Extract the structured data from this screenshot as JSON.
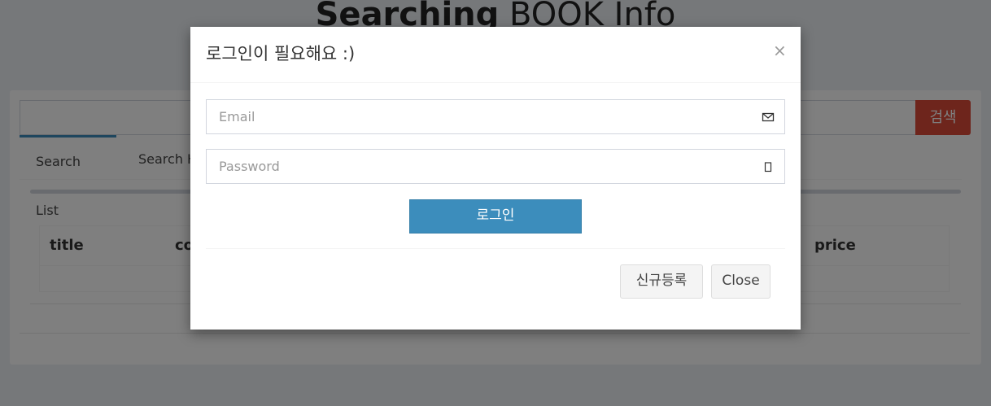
{
  "page": {
    "title_bold": "Searching",
    "title_light": " BOOK Info"
  },
  "search": {
    "button_label": "검색",
    "input_value": ""
  },
  "tabs": [
    {
      "label": "Search List",
      "active": true
    },
    {
      "label": "Search H"
    }
  ],
  "table": {
    "headers": [
      "title",
      "co",
      "price"
    ]
  },
  "modal": {
    "title": "로그인이 필요해요 :)",
    "close_symbol": "×",
    "email_placeholder": "Email",
    "password_placeholder": "Password",
    "login_label": "로그인",
    "register_label": "신규등록",
    "close_label": "Close"
  },
  "colors": {
    "primary": "#3c8dbc",
    "danger": "#dd4b39",
    "overlay": "rgba(0,0,0,0.5)"
  },
  "icons": {
    "email_field": "envelope-icon",
    "password_field": "lock-icon",
    "modal_close": "close-icon"
  }
}
